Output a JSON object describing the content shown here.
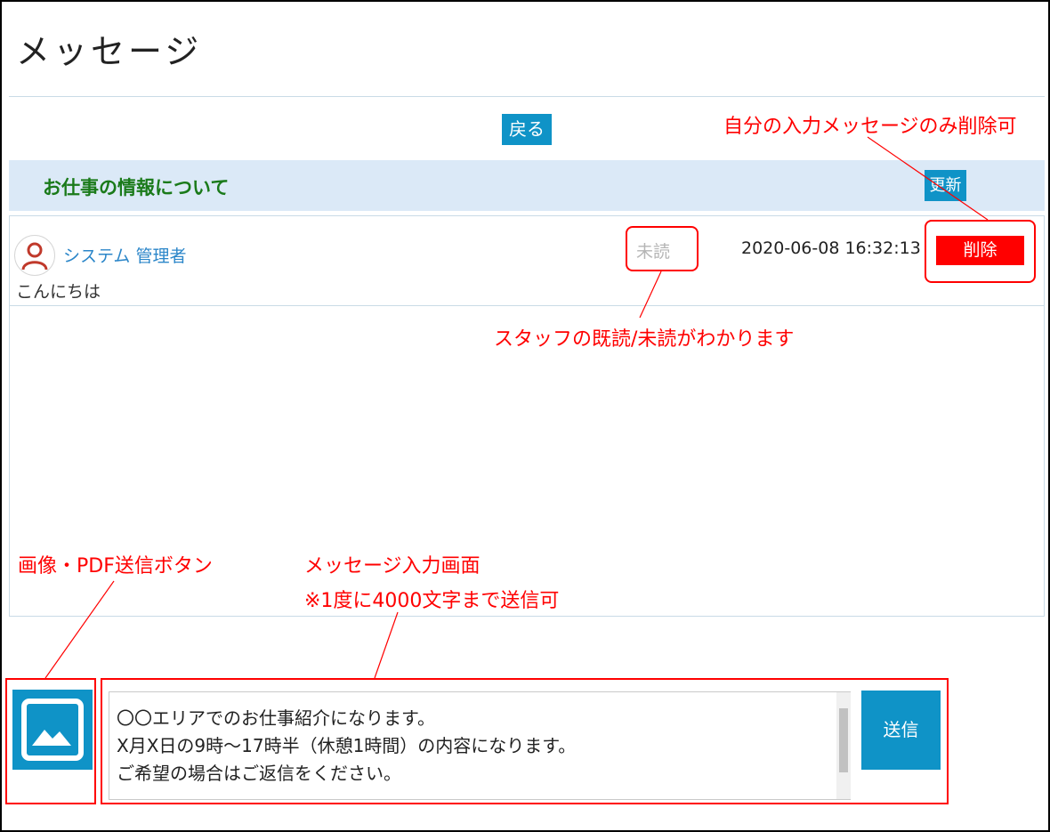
{
  "page": {
    "title": "メッセージ"
  },
  "toolbar": {
    "back_label": "戻る"
  },
  "thread": {
    "title": "お仕事の情報について",
    "update_label": "更新"
  },
  "message": {
    "sender": "システム 管理者",
    "body": "こんにちは",
    "read_status": "未読",
    "timestamp": "2020-06-08 16:32:13",
    "delete_label": "削除"
  },
  "composer": {
    "text": "〇〇エリアでのお仕事紹介になります。\nX月X日の9時～17時半（休憩1時間）の内容になります。\nご希望の場合はご返信をください。",
    "send_label": "送信"
  },
  "annotations": {
    "delete_note": "自分の入力メッセージのみ削除可",
    "read_note": "スタッフの既読/未読がわかります",
    "upload_note": "画像・PDF送信ボタン",
    "input_note_1": "メッセージ入力画面",
    "input_note_2": "※1度に4000文字まで送信可"
  },
  "colors": {
    "accent": "#0f93c7",
    "danger": "#ff0000",
    "header_bg": "#dbe9f7",
    "thread_title": "#1a7a1a",
    "sender_link": "#2b86c9"
  }
}
